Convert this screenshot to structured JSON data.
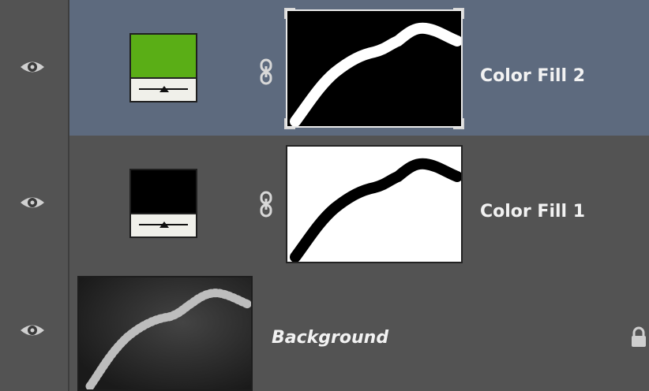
{
  "layers_panel": {
    "layers": [
      {
        "name": "Color Fill 2",
        "selected": true,
        "fill_color": "#5aae16",
        "visible": true,
        "icon": "eye-icon"
      },
      {
        "name": "Color Fill 1",
        "selected": false,
        "fill_color": "#000000",
        "visible": true,
        "icon": "eye-icon"
      },
      {
        "name": "Background",
        "selected": false,
        "locked": true,
        "visible": true,
        "icon": "eye-icon"
      }
    ]
  },
  "colors": {
    "selected_row": "#5d6a7e",
    "panel_bg": "#535353",
    "text": "#f2f2f2"
  }
}
